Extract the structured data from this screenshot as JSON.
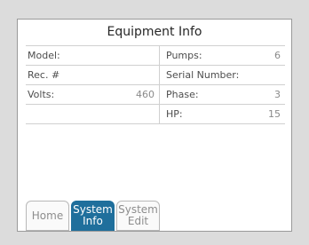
{
  "screen": {
    "title": "Equipment Info"
  },
  "fields": {
    "model": {
      "label": "Model:",
      "value": ""
    },
    "pumps": {
      "label": "Pumps:",
      "value": "6"
    },
    "rec": {
      "label": "Rec. #",
      "value": ""
    },
    "serial": {
      "label": "Serial Number:",
      "value": ""
    },
    "volts": {
      "label": "Volts:",
      "value": "460"
    },
    "phase": {
      "label": "Phase:",
      "value": "3"
    },
    "hp": {
      "label": "HP:",
      "value": "15"
    }
  },
  "tabs": {
    "home": {
      "label": "Home"
    },
    "system_info": {
      "label_line1": "System",
      "label_line2": "Info"
    },
    "system_edit": {
      "label_line1": "System",
      "label_line2": "Edit"
    }
  },
  "colors": {
    "active_tab": "#1f6f9c",
    "panel_bg": "#ffffff",
    "page_bg": "#dcdcdc"
  }
}
